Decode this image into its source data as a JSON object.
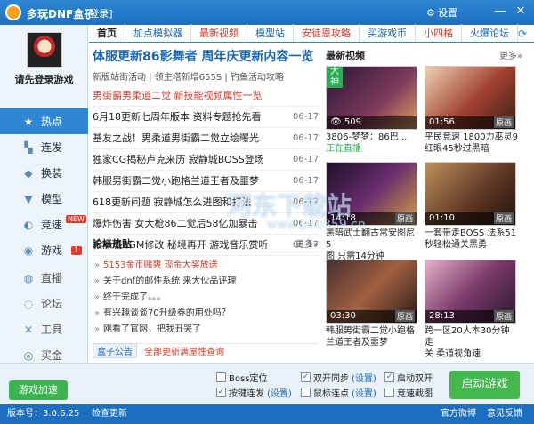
{
  "app": {
    "title": "多玩DNF盒子",
    "login_link": "[登录]",
    "settings": "设置"
  },
  "window_controls": {
    "minimize": "—",
    "close": "✕"
  },
  "sidebar": {
    "login_prompt": "请先登录游戏",
    "items": [
      {
        "icon": "★",
        "label": "热点"
      },
      {
        "icon": "▚",
        "label": "连发"
      },
      {
        "icon": "◆",
        "label": "换装"
      },
      {
        "icon": "▼",
        "label": "模型"
      },
      {
        "icon": "◐",
        "label": "竞速",
        "badge": "NEW"
      },
      {
        "icon": "◉",
        "label": "游戏",
        "count": "1"
      }
    ],
    "tools": [
      {
        "icon": "◍",
        "label": "直播"
      },
      {
        "icon": "◌",
        "label": "论坛"
      },
      {
        "icon": "✕",
        "label": "工具"
      },
      {
        "icon": "◎",
        "label": "买金"
      }
    ]
  },
  "tabs": [
    "首页",
    "加点模拟器",
    "最新视频",
    "模型站",
    "安徒恩攻略",
    "买游戏币",
    "小四格",
    "火爆论坛"
  ],
  "news": {
    "headline": "体服更新86影舞者 周年庆更新内容一览",
    "subline": "新版站街活动 | 领主塔新增655S | 钓鱼活动攻略",
    "items": [
      {
        "text": "男街霸男柔道二觉 新技能视频属性一览",
        "date": "",
        "red": true
      },
      {
        "text": "6月18更新七周年版本 资料专题抢先看",
        "date": "06-17"
      },
      {
        "text": "基友之战！男柔道男街霸二觉立绘曝光",
        "date": "06-17"
      },
      {
        "text": "独家CG揭秘卢克来历 寂静城BOSS登场",
        "date": "06-17"
      },
      {
        "text": "韩服男街霸二觉小跑格兰道王者及噩梦",
        "date": "06-17"
      },
      {
        "text": "618更新问题 寂静城怎么进图和打法",
        "date": "06-17"
      },
      {
        "text": "爆炸伤害 女大枪86二觉后58亿加暴击",
        "date": "06-17"
      },
      {
        "text": "寂静城BGM修改 秘境再开 游戏音乐赏听",
        "date": "06-17"
      }
    ]
  },
  "forum": {
    "title": "论坛热贴",
    "more": "更多»",
    "items": [
      {
        "text": "5153金币赌爽 现金大奖放送",
        "red": true
      },
      {
        "text": "关于dnf的邮件系统 来大伙品评理"
      },
      {
        "text": "终于完成了。。。"
      },
      {
        "text": "有兴趣谈谈70升级券的用处吗？"
      },
      {
        "text": "刚看了官网，把我丑哭了"
      }
    ]
  },
  "notice": {
    "tag": "盒子公告",
    "text": "全部更新满屋性查询"
  },
  "videos": {
    "title": "最新视频",
    "more": "更多»",
    "items": [
      {
        "time": "509",
        "source": "",
        "caption": "3806-梦梦：86巴...",
        "caption2": "正在直播",
        "live": "大神",
        "color": "#3a1e3c"
      },
      {
        "time": "01:56",
        "source": "原画",
        "caption": "平民竞速 1800力巫灵9",
        "caption2": "红眼45秒过黑暗",
        "color": "#7a4a2a"
      },
      {
        "time": "14:18",
        "source": "原画",
        "caption": "黑暗武士翻古常安图尼5",
        "caption2": "图 只需14分钟",
        "color": "#2c1a35"
      },
      {
        "time": "01:10",
        "source": "原画",
        "caption": "一套带走BOSS 法系51",
        "caption2": "秒轻松通关黑勇",
        "color": "#5a3a2a"
      },
      {
        "time": "03:30",
        "source": "原画",
        "caption": "韩服男街霸二觉小跑格",
        "caption2": "兰道王者及噩梦",
        "color": "#3c2a2a"
      },
      {
        "time": "28:13",
        "source": "原画",
        "caption": "跨一区20人本30分钟走",
        "caption2": "关 柔道视角速",
        "color": "#5a2e4a"
      }
    ]
  },
  "footer": {
    "speed_label": "游戏加速",
    "options": [
      {
        "label": "Boss定位",
        "checked": false,
        "setting": ""
      },
      {
        "label": "按键连发",
        "checked": true,
        "setting": "(设置)"
      },
      {
        "label": "双开同步",
        "checked": true,
        "setting": "(设置)"
      },
      {
        "label": "鼠标连点",
        "checked": false,
        "setting": "(设置)"
      },
      {
        "label": "启动双开",
        "checked": true,
        "setting": ""
      },
      {
        "label": "竞速截图",
        "checked": false,
        "setting": ""
      }
    ],
    "start_label": "启动游戏"
  },
  "status": {
    "version": "版本号：3.0.6.25",
    "check": "检查更新",
    "weibo": "官方微博",
    "feedback": "意见反馈"
  },
  "watermark": {
    "line1": "河东下载站",
    "line2": "www.pc0359.cn"
  }
}
